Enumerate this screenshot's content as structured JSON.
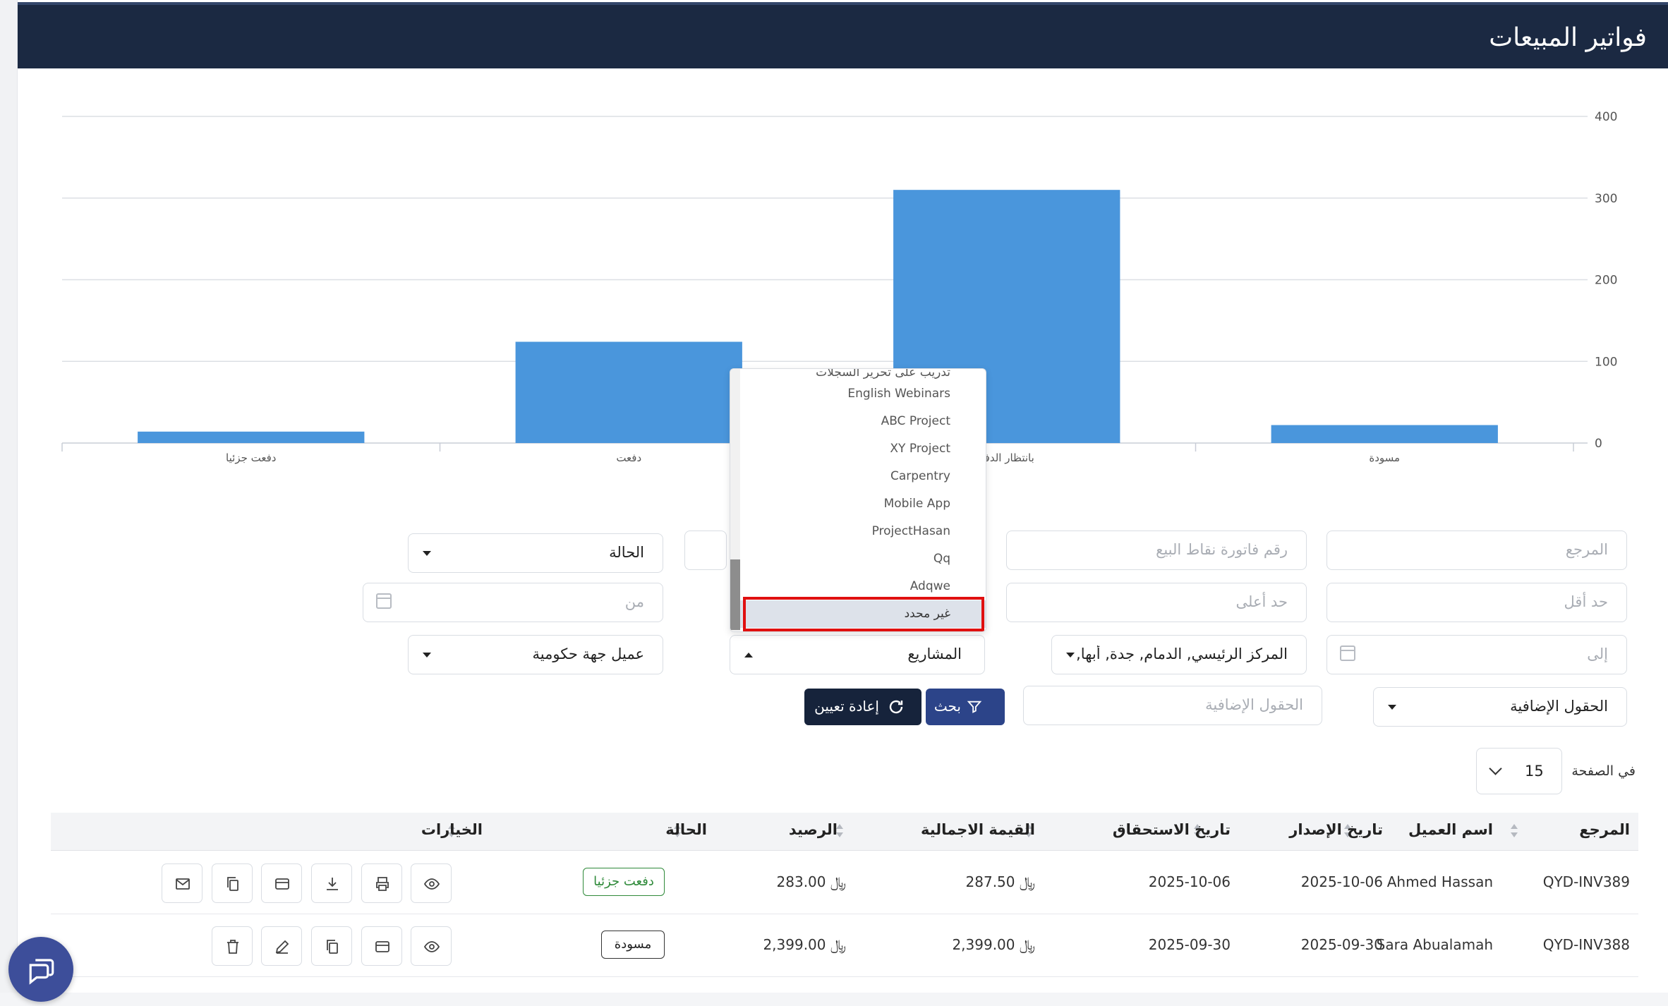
{
  "header": {
    "title": "فواتير المبيعات"
  },
  "chart_data": {
    "type": "bar",
    "categories": [
      "دفعت جزئيا",
      "دفعت",
      "بانتظار الدفع",
      "مسودة"
    ],
    "values": [
      14,
      124,
      310,
      22
    ],
    "ylim": [
      0,
      400
    ],
    "yticks": [
      0,
      100,
      200,
      300,
      400
    ],
    "grid": true,
    "color": "#4a96dc"
  },
  "filters": {
    "reference_ph": "المرجع",
    "pos_invoice_ph": "رقم فاتورة نقاط البيع",
    "status": "الحالة",
    "min1_ph": "حد أقل",
    "max1_ph": "حد أعلى",
    "from_ph": "من",
    "to_ph": "إلى",
    "branches": "المركز الرئيسي, الدمام, جدة, أبها, الف",
    "projects": "المشاريع",
    "customer_type": "عميل جهة حكومية",
    "extra_fields": "الحقول الإضافية",
    "extra_fields_ph": "الحقول الإضافية",
    "search_btn": "بحث",
    "reset_btn": "إعادة تعيين"
  },
  "dropdown": {
    "cut_top": "تدريب على تحرير السجلات",
    "options": [
      "English Webinars",
      "ABC Project",
      "XY Project",
      "Carpentry",
      "Mobile App",
      "ProjectHasan",
      "Qq",
      "Adqwe",
      "غير محدد"
    ]
  },
  "pagination": {
    "per_page_label": "في الصفحة",
    "per_page": "15"
  },
  "table": {
    "headers": [
      "المرجع",
      "اسم العميل",
      "تاريخ الإصدار",
      "تاريخ الاستحقاق",
      "القيمة الاجمالية",
      "الرصيد",
      "الحالة",
      "الخيارات"
    ],
    "rows": [
      {
        "ref": "QYD-INV389",
        "customer": "Ahmed Hassan",
        "issue": "2025-10-06",
        "due": "2025-10-06",
        "total": "287.50 ﷼",
        "balance": "283.00 ﷼",
        "status": "دفعت جزئيا"
      },
      {
        "ref": "QYD-INV388",
        "customer": "Sara Abualamah",
        "issue": "2025-09-30",
        "due": "2025-09-30",
        "total": "2,399.00 ﷼",
        "balance": "2,399.00 ﷼",
        "status": "مسودة"
      }
    ]
  },
  "colors": {
    "header_bg": "#1b2942",
    "primary_btn": "#2c4489",
    "dark_btn": "#16233b",
    "bar": "#4a96dc",
    "partial_badge": "#2f8a3a"
  }
}
